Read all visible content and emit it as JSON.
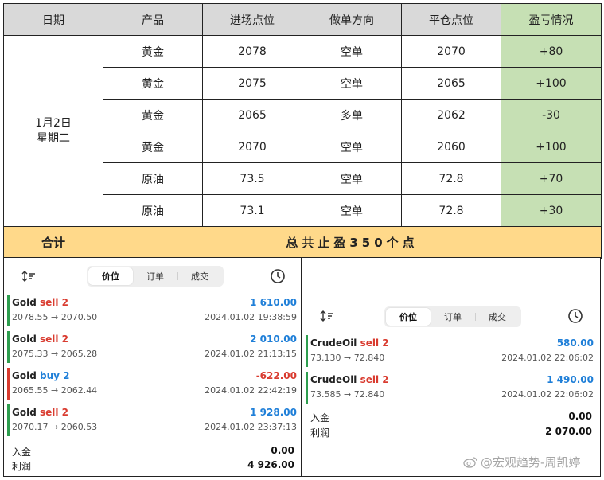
{
  "table": {
    "headers": [
      "日期",
      "产品",
      "进场点位",
      "做单方向",
      "平仓点位",
      "盈亏情况"
    ],
    "date_line1": "1月2日",
    "date_line2": "星期二",
    "rows": [
      {
        "product": "黄金",
        "entry": "2078",
        "direction": "空单",
        "exit": "2070",
        "pl": "+80"
      },
      {
        "product": "黄金",
        "entry": "2075",
        "direction": "空单",
        "exit": "2065",
        "pl": "+100"
      },
      {
        "product": "黄金",
        "entry": "2065",
        "direction": "多单",
        "exit": "2062",
        "pl": "-30"
      },
      {
        "product": "黄金",
        "entry": "2070",
        "direction": "空单",
        "exit": "2060",
        "pl": "+100"
      },
      {
        "product": "原油",
        "entry": "73.5",
        "direction": "空单",
        "exit": "72.8",
        "pl": "+70"
      },
      {
        "product": "原油",
        "entry": "73.1",
        "direction": "空单",
        "exit": "72.8",
        "pl": "+30"
      }
    ],
    "total_label": "合计",
    "total_text": "总共止盈350个点"
  },
  "tabs": [
    "价位",
    "订单",
    "成交"
  ],
  "left_panel": {
    "trades": [
      {
        "symbol": "Gold",
        "side": "sell 2",
        "prices": "2078.55 → 2070.50",
        "pnl": "1 610.00",
        "time": "2024.01.02 19:38:59"
      },
      {
        "symbol": "Gold",
        "side": "sell 2",
        "prices": "2075.33 → 2065.28",
        "pnl": "2 010.00",
        "time": "2024.01.02 21:13:15"
      },
      {
        "symbol": "Gold",
        "side": "buy 2",
        "prices": "2065.55 → 2062.44",
        "pnl": "-622.00",
        "time": "2024.01.02 22:42:19"
      },
      {
        "symbol": "Gold",
        "side": "sell 2",
        "prices": "2070.17 → 2060.53",
        "pnl": "1 928.00",
        "time": "2024.01.02 23:37:13"
      }
    ],
    "deposit_label": "入金",
    "deposit_value": "0.00",
    "profit_label": "利润",
    "profit_value": "4 926.00"
  },
  "right_panel": {
    "trades": [
      {
        "symbol": "CrudeOil",
        "side": "sell 2",
        "prices": "73.130 → 72.840",
        "pnl": "580.00",
        "time": "2024.01.02 22:06:02"
      },
      {
        "symbol": "CrudeOil",
        "side": "sell 2",
        "prices": "73.585 → 72.840",
        "pnl": "1 490.00",
        "time": "2024.01.02 22:06:02"
      }
    ],
    "deposit_label": "入金",
    "deposit_value": "0.00",
    "profit_label": "利润",
    "profit_value": "2 070.00"
  },
  "watermark": "@宏观趋势-周凯婷",
  "colors": {
    "header_gray": "#d9d9d9",
    "profit_green": "#c6e0b4",
    "total_yellow": "#ffd98a",
    "sell_red": "#d93b2f",
    "buy_blue": "#1f7fd8",
    "bar_green": "#2e9e4f",
    "bar_red": "#d93b2f"
  },
  "icons": [
    "sort-icon",
    "clock-icon",
    "weibo-icon"
  ]
}
